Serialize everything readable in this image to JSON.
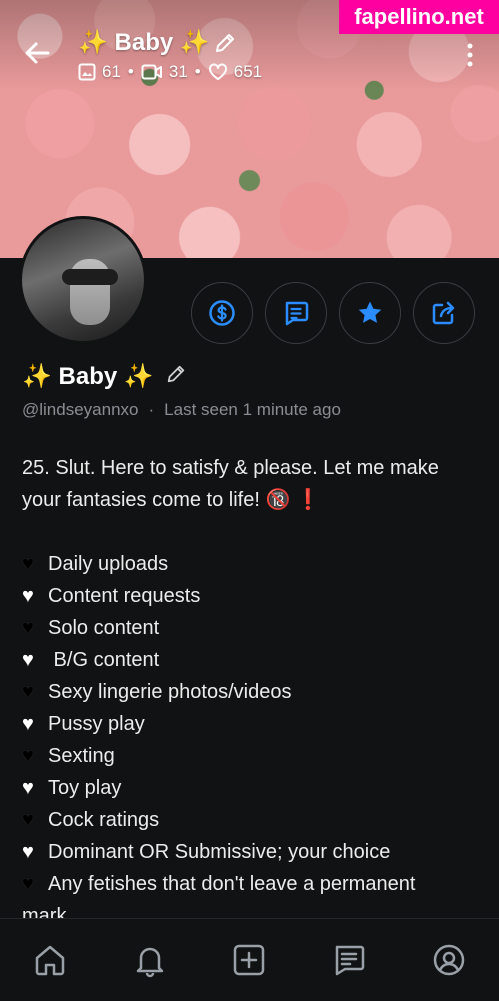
{
  "header": {
    "title": "✨ Baby ✨",
    "stats": {
      "photos": "61",
      "videos": "31",
      "likes": "651"
    },
    "separator": "•"
  },
  "watermark": {
    "text": "fapellino.net",
    "color": "#ff00a0"
  },
  "profile": {
    "display_name": "✨ Baby ✨",
    "username": "@lindseyannxo",
    "dot": "·",
    "last_seen": "Last seen 1 minute ago"
  },
  "actions": [
    {
      "icon": "dollar-icon"
    },
    {
      "icon": "message-icon"
    },
    {
      "icon": "star-icon"
    },
    {
      "icon": "share-icon"
    }
  ],
  "bio": {
    "intro_line1": "25. Slut. Here to satisfy & please. Let me make",
    "intro_line2": "your fantasies come to life! 🔞 ❗",
    "items": [
      {
        "heart": "black",
        "text": "Daily uploads"
      },
      {
        "heart": "white",
        "text": "Content requests"
      },
      {
        "heart": "black",
        "text": "Solo content"
      },
      {
        "heart": "white",
        "text": " B/G content"
      },
      {
        "heart": "black",
        "text": "Sexy lingerie photos/videos"
      },
      {
        "heart": "white",
        "text": "Pussy play"
      },
      {
        "heart": "black",
        "text": "Sexting"
      },
      {
        "heart": "white",
        "text": "Toy play"
      },
      {
        "heart": "black",
        "text": "Cock ratings"
      },
      {
        "heart": "white",
        "text": "Dominant OR Submissive; your choice"
      },
      {
        "heart": "black",
        "text": "Any fetishes that don't leave a permanent"
      }
    ],
    "last_line": "mark",
    "heart_glyph": "♥"
  },
  "nav": [
    "home-icon",
    "bell-icon",
    "add-post-icon",
    "chat-icon",
    "profile-icon"
  ],
  "colors": {
    "background": "#111213",
    "accent": "#2b8cff",
    "muted": "#8a8d93"
  }
}
